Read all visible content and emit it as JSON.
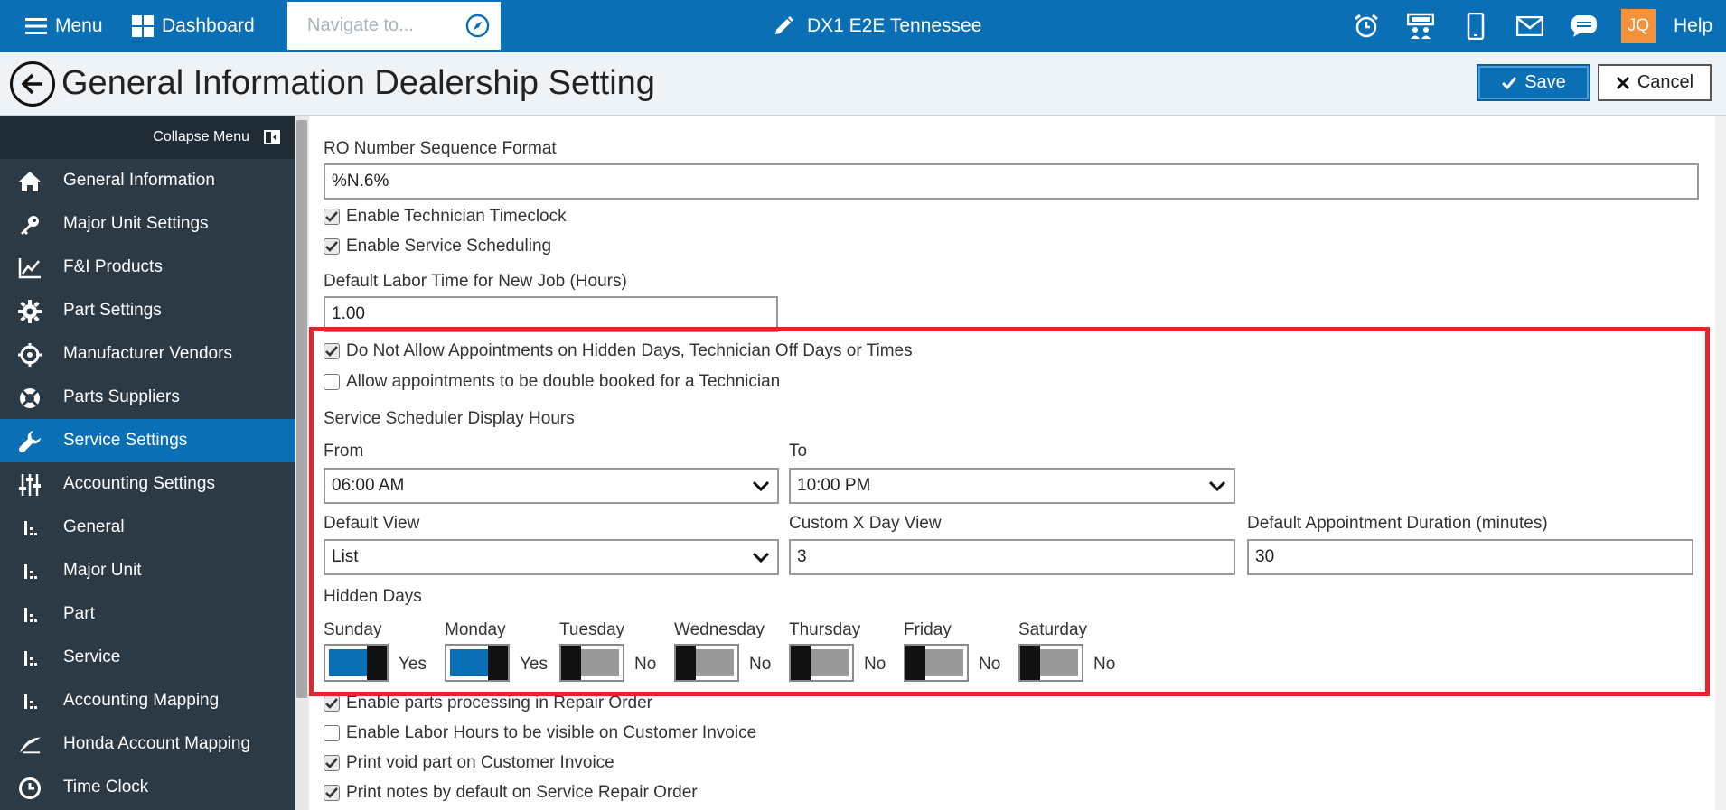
{
  "topbar": {
    "menu_label": "Menu",
    "dashboard_label": "Dashboard",
    "navigate_placeholder": "Navigate to...",
    "store_title": "DX1 E2E Tennessee",
    "user_initials": "JQ",
    "help_label": "Help"
  },
  "header": {
    "title": "General Information Dealership Setting",
    "save_label": "Save",
    "cancel_label": "Cancel"
  },
  "sidebar": {
    "collapse_label": "Collapse Menu",
    "items": [
      {
        "label": "General Information",
        "icon": "home-icon"
      },
      {
        "label": "Major Unit Settings",
        "icon": "key-icon"
      },
      {
        "label": "F&I Products",
        "icon": "chart-icon"
      },
      {
        "label": "Part Settings",
        "icon": "gear-icon"
      },
      {
        "label": "Manufacturer Vendors",
        "icon": "target-icon"
      },
      {
        "label": "Parts Suppliers",
        "icon": "lifebuoy-icon"
      },
      {
        "label": "Service Settings",
        "icon": "wrench-icon",
        "active": true
      },
      {
        "label": "Accounting Settings",
        "icon": "sliders-icon"
      },
      {
        "label": "General",
        "icon": "sub-item-icon"
      },
      {
        "label": "Major Unit",
        "icon": "sub-item-icon"
      },
      {
        "label": "Part",
        "icon": "sub-item-icon"
      },
      {
        "label": "Service",
        "icon": "sub-item-icon"
      },
      {
        "label": "Accounting Mapping",
        "icon": "sub-item-icon"
      },
      {
        "label": "Honda Account Mapping",
        "icon": "honda-wing-icon"
      },
      {
        "label": "Time Clock",
        "icon": "clock-icon"
      }
    ]
  },
  "form": {
    "ro_format_label": "RO Number Sequence Format",
    "ro_format_value": "%N.6%",
    "enable_timeclock": "Enable Technician Timeclock",
    "enable_scheduling": "Enable Service Scheduling",
    "default_labor_label": "Default Labor Time for New Job (Hours)",
    "default_labor_value": "1.00",
    "no_hidden_appts": "Do Not Allow Appointments on Hidden Days, Technician Off Days or Times",
    "double_book": "Allow appointments to be double booked for a Technician",
    "display_hours_label": "Service Scheduler Display Hours",
    "from_label": "From",
    "from_value": "06:00 AM",
    "to_label": "To",
    "to_value": "10:00 PM",
    "default_view_label": "Default View",
    "default_view_value": "List",
    "custom_x_label": "Custom X Day View",
    "custom_x_value": "3",
    "default_duration_label": "Default Appointment Duration (minutes)",
    "default_duration_value": "30",
    "hidden_days_label": "Hidden Days",
    "days": [
      {
        "name": "Sunday",
        "state": "Yes",
        "on": true
      },
      {
        "name": "Monday",
        "state": "Yes",
        "on": true
      },
      {
        "name": "Tuesday",
        "state": "No",
        "on": false
      },
      {
        "name": "Wednesday",
        "state": "No",
        "on": false
      },
      {
        "name": "Thursday",
        "state": "No",
        "on": false
      },
      {
        "name": "Friday",
        "state": "No",
        "on": false
      },
      {
        "name": "Saturday",
        "state": "No",
        "on": false
      }
    ],
    "parts_processing": "Enable parts processing in Repair Order",
    "labor_visible": "Enable Labor Hours to be visible on Customer Invoice",
    "print_void": "Print void part on Customer Invoice",
    "print_notes": "Print notes by default on Service Repair Order"
  },
  "colors": {
    "primary": "#0a6fb5",
    "sidebar_bg": "#2b3a45",
    "highlight": "#e0262c",
    "avatar": "#f4913a"
  }
}
